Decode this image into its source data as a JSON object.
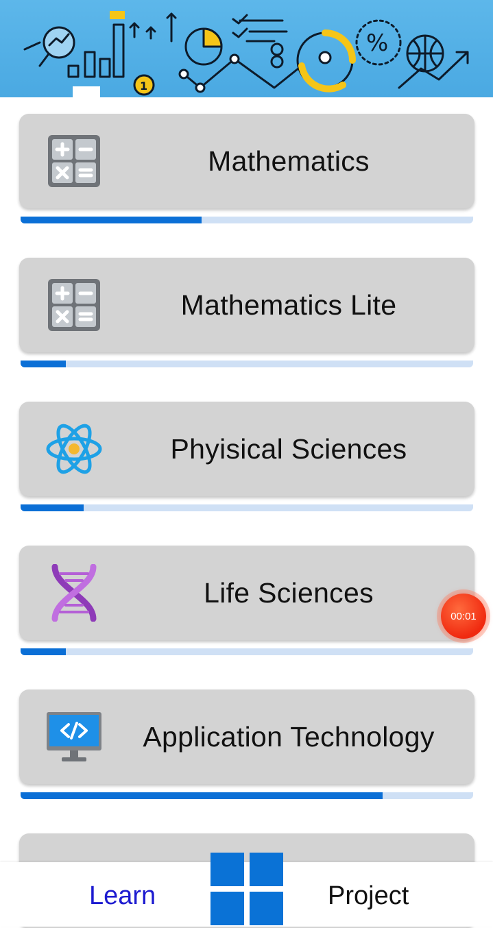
{
  "header": {
    "banner_image": "science-analytics-banner",
    "banner_color": "#55b3e8"
  },
  "subjects": [
    {
      "title": "Mathematics",
      "icon": "calculator-icon",
      "progress": 0.4
    },
    {
      "title": "Mathematics Lite",
      "icon": "calculator-icon",
      "progress": 0.1
    },
    {
      "title": "Phyisical Sciences",
      "icon": "atom-icon",
      "progress": 0.14
    },
    {
      "title": "Life Sciences",
      "icon": "dna-icon",
      "progress": 0.1
    },
    {
      "title": "Application Technology",
      "icon": "computer-code-icon",
      "progress": 0.8
    },
    {
      "title": "",
      "icon": "partial-icon",
      "progress": 0
    }
  ],
  "recorder": {
    "time": "00:01",
    "color": "#f02a10"
  },
  "bottom_nav": {
    "learn_label": "Learn",
    "project_label": "Project",
    "center_icon": "grid-menu-icon",
    "active_color": "#1d1bd0",
    "accent": "#0a72d6"
  }
}
